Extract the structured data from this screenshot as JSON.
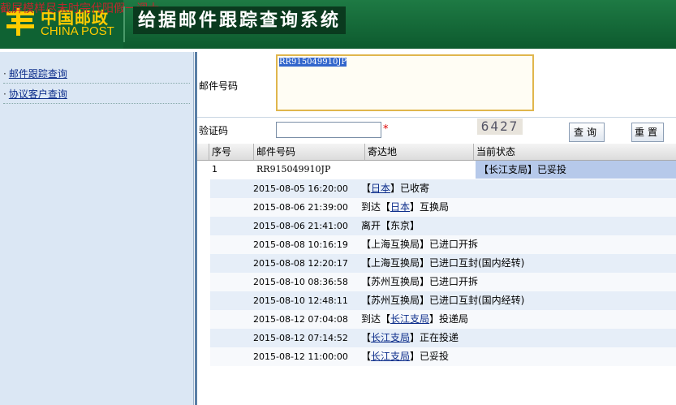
{
  "header": {
    "overlay_text": "截屏模样尽未时完代阳假一调士",
    "logo_cn": "中国邮政",
    "logo_en": "CHINA POST",
    "title": "给据邮件跟踪查询系统"
  },
  "sidebar": {
    "items": [
      {
        "label": "邮件跟踪查询"
      },
      {
        "label": "协议客户查询"
      }
    ]
  },
  "form": {
    "mail_label": "邮件号码",
    "mail_value": "RR915049910JP",
    "verify_label": "验证码",
    "verify_value": "",
    "required_mark": "*",
    "captcha": "6427",
    "query_button": "查询",
    "reset_button": "重置"
  },
  "table": {
    "headers": [
      "序号",
      "邮件号码",
      "寄达地",
      "当前状态"
    ],
    "row": {
      "index": "1",
      "mail_no": "RR915049910JP",
      "destination": "",
      "status": "【长江支局】已妥投"
    },
    "details": [
      {
        "time": "2015-08-05 16:20:00",
        "pre": "【",
        "link": "日本",
        "post": "】已收寄"
      },
      {
        "time": "2015-08-06 21:39:00",
        "pre": "到达【",
        "link": "日本",
        "post": "】互换局"
      },
      {
        "time": "2015-08-06 21:41:00",
        "pre": "离开【东京】",
        "link": "",
        "post": ""
      },
      {
        "time": "2015-08-08 10:16:19",
        "pre": "【上海互换局】已进口开拆",
        "link": "",
        "post": ""
      },
      {
        "time": "2015-08-08 12:20:17",
        "pre": "【上海互换局】已进口互封(国内经转)",
        "link": "",
        "post": ""
      },
      {
        "time": "2015-08-10 08:36:58",
        "pre": "【苏州互换局】已进口开拆",
        "link": "",
        "post": ""
      },
      {
        "time": "2015-08-10 12:48:11",
        "pre": "【苏州互换局】已进口互封(国内经转)",
        "link": "",
        "post": ""
      },
      {
        "time": "2015-08-12 07:04:08",
        "pre": "到达【",
        "link": "长江支局",
        "post": "】投递局"
      },
      {
        "time": "2015-08-12 07:14:52",
        "pre": "【",
        "link": "长江支局",
        "post": "】正在投递"
      },
      {
        "time": "2015-08-12 11:00:00",
        "pre": "【",
        "link": "长江支局",
        "post": "】已妥投"
      }
    ]
  }
}
